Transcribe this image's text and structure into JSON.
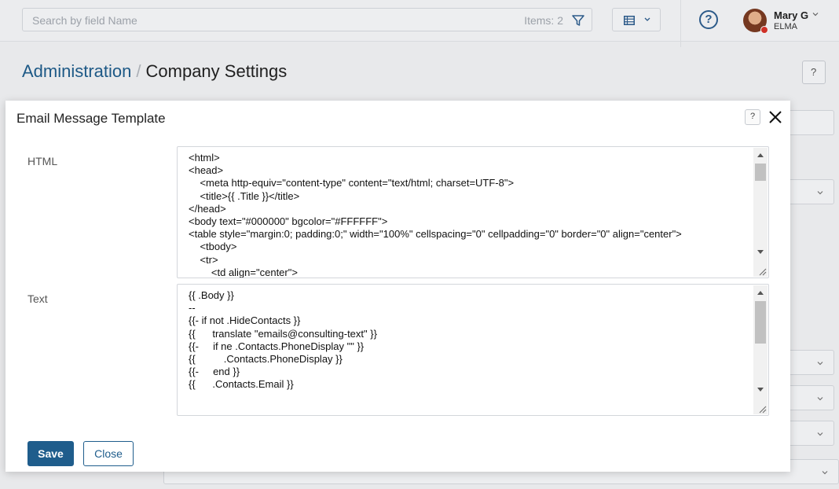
{
  "search": {
    "placeholder": "Search by field Name",
    "count": "Items: 2"
  },
  "user": {
    "name": "Mary G",
    "org": "ELMA"
  },
  "breadcrumb": {
    "parent": "Administration",
    "separator": "/",
    "current": "Company Settings"
  },
  "modal": {
    "title": "Email Message Template",
    "html_label": "HTML",
    "html_lines": [
      "<html>",
      "<head>",
      "    <meta http-equiv=\"content-type\" content=\"text/html; charset=UTF-8\">",
      "    <title>{{ .Title }}</title>",
      "</head>",
      "<body text=\"#000000\" bgcolor=\"#FFFFFF\">",
      "<table style=\"margin:0; padding:0;\" width=\"100%\" cellspacing=\"0\" cellpadding=\"0\" border=\"0\" align=\"center\">",
      "    <tbody>",
      "    <tr>",
      "        <td align=\"center\">"
    ],
    "text_label": "Text",
    "text_lines": [
      "{{ .Body }}",
      "",
      "--",
      "{{- if not .HideContacts }}",
      "{{      translate \"emails@consulting-text\" }}",
      "{{-     if ne .Contacts.PhoneDisplay \"\" }}",
      "{{          .Contacts.PhoneDisplay }}",
      "{{-     end }}",
      "{{      .Contacts.Email }}"
    ],
    "save_label": "Save",
    "close_label": "Close"
  },
  "colors": {
    "accent": "#1f5d8c",
    "notification": "#d8342a"
  },
  "icons": [
    "filter-icon",
    "table-view-icon",
    "chevron-down-icon",
    "help-icon",
    "close-icon",
    "resize-handle-icon"
  ]
}
